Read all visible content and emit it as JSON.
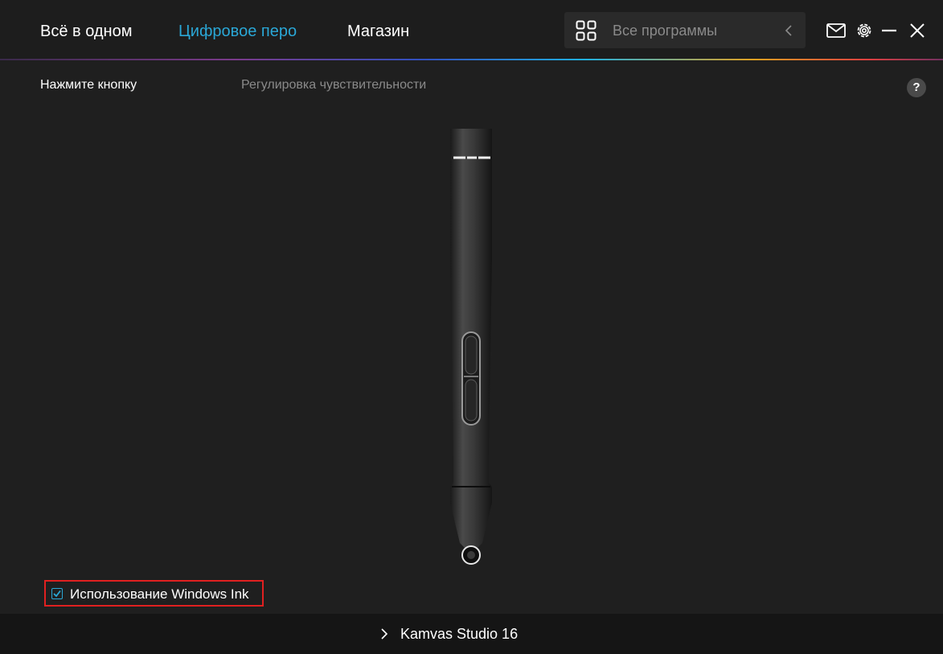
{
  "nav": {
    "tabs": [
      {
        "label": "Всё в одном",
        "active": false
      },
      {
        "label": "Цифровое перо",
        "active": true
      },
      {
        "label": "Магазин",
        "active": false
      }
    ]
  },
  "search": {
    "placeholder": "Все программы"
  },
  "subtabs": [
    {
      "label": "Нажмите кнопку",
      "active": true
    },
    {
      "label": "Регулировка чувствительности",
      "active": false
    }
  ],
  "help": {
    "label": "?"
  },
  "windows_ink": {
    "label": "Использование Windows Ink",
    "checked": true
  },
  "footer": {
    "device": "Kamvas Studio 16"
  },
  "colors": {
    "background": "#1f1f1f",
    "accent": "#2aa7d6",
    "highlight_border": "#e02020",
    "inactive_text": "#8a8a8a"
  },
  "icons": [
    "grid-icon",
    "chevron-left-icon",
    "mail-icon",
    "gear-icon",
    "minimize-icon",
    "close-icon",
    "help-icon",
    "check-icon",
    "chevron-right-icon"
  ]
}
